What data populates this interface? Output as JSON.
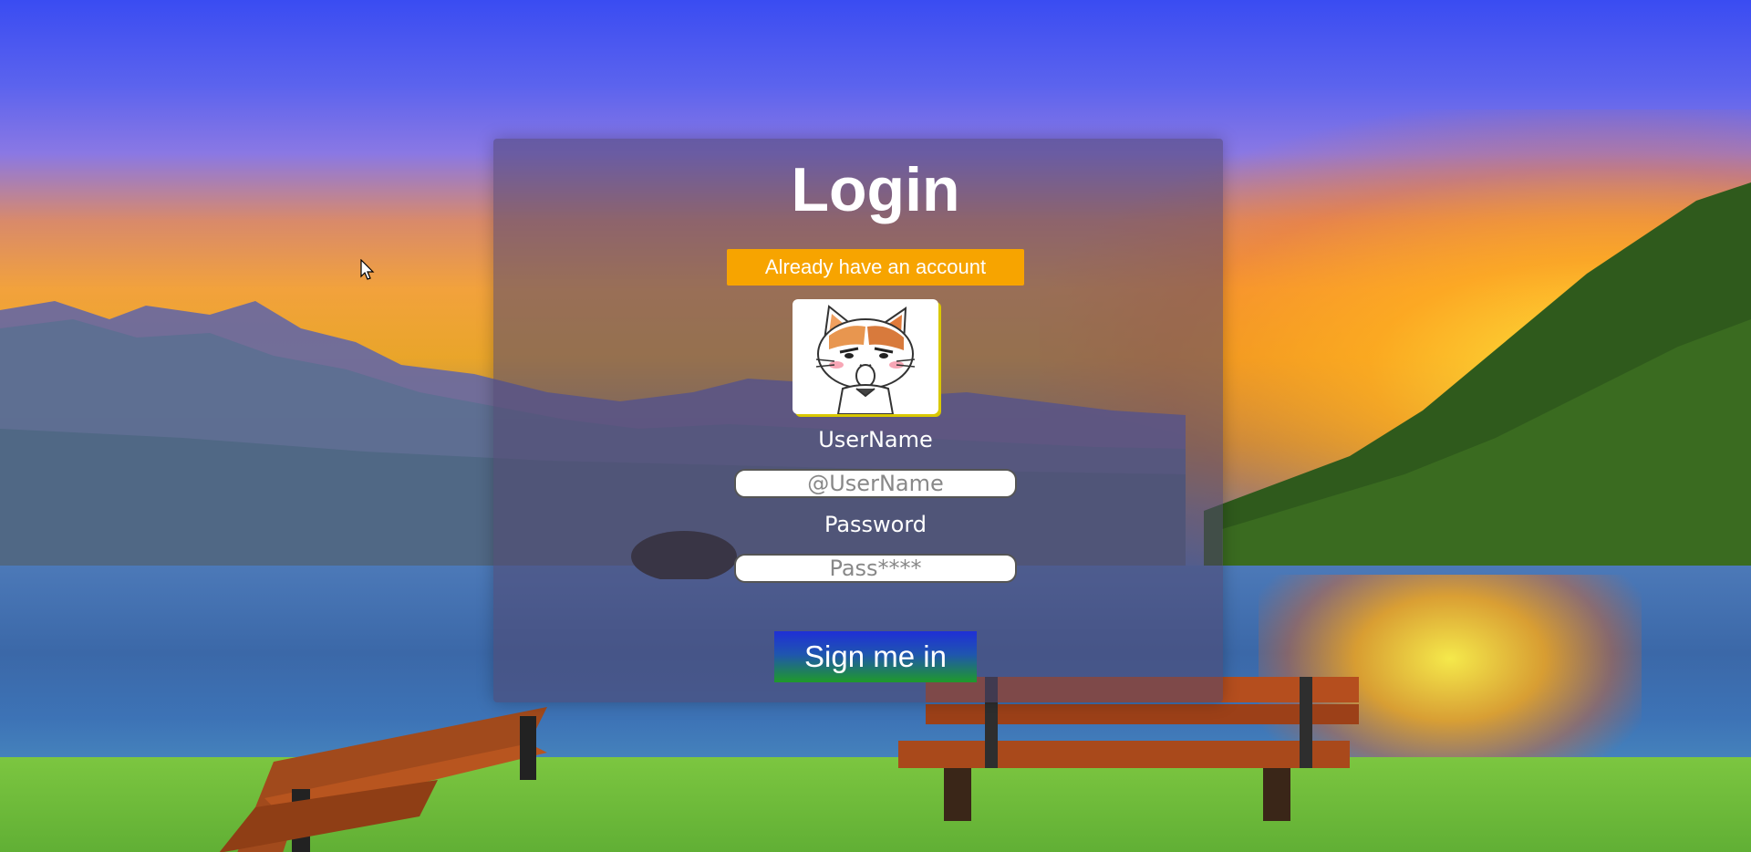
{
  "login": {
    "title": "Login",
    "account_button_label": "Already have an account",
    "avatar_icon": "cat-avatar-icon",
    "username_label": "UserName",
    "username_placeholder": "@UserName",
    "username_value": "",
    "password_label": "Password",
    "password_placeholder": "Pass****",
    "password_value": "",
    "signin_label": "Sign me in"
  },
  "colors": {
    "account_button": "#f7a400",
    "signin_gradient_top": "#1f2fd6",
    "signin_gradient_bottom": "#1f9a2a",
    "card_overlay": "rgba(80, 70, 110, 0.55)",
    "text": "#ffffff"
  }
}
